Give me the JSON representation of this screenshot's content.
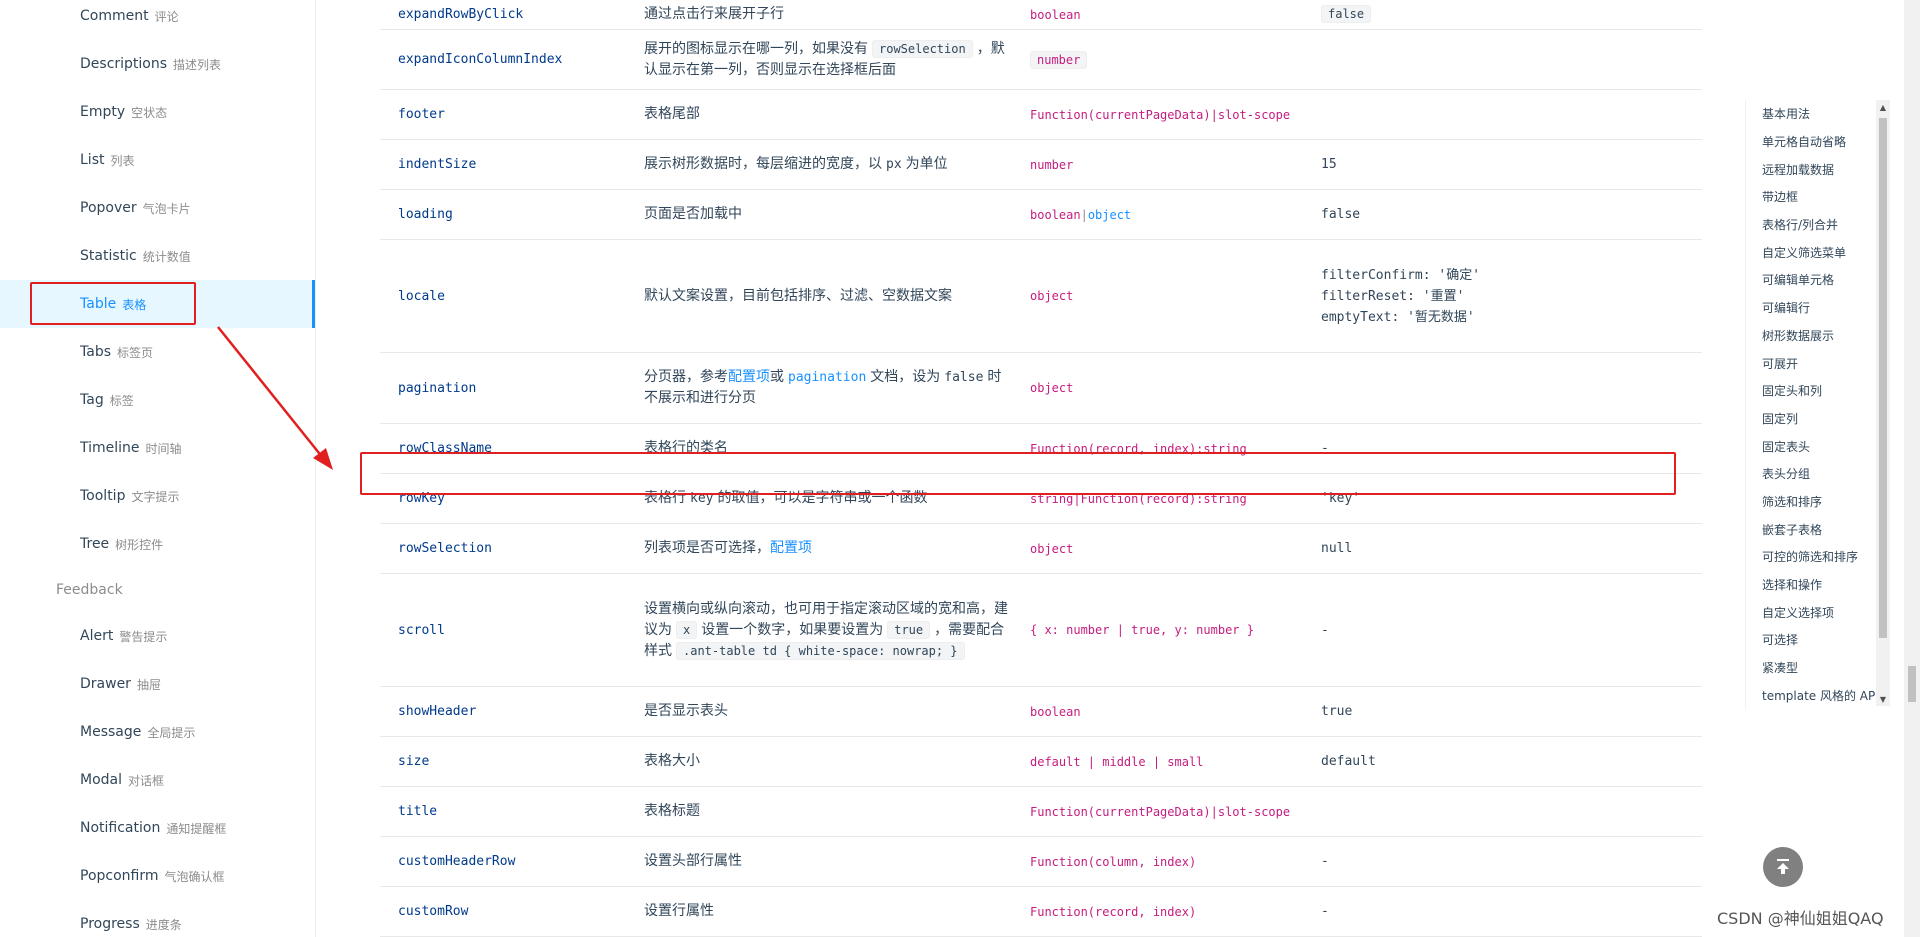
{
  "sidebar": {
    "items_top": [
      {
        "label": "Comment",
        "sub": "评论"
      },
      {
        "label": "Descriptions",
        "sub": "描述列表"
      },
      {
        "label": "Empty",
        "sub": "空状态"
      },
      {
        "label": "List",
        "sub": "列表"
      },
      {
        "label": "Popover",
        "sub": "气泡卡片"
      },
      {
        "label": "Statistic",
        "sub": "统计数值"
      },
      {
        "label": "Table",
        "sub": "表格"
      },
      {
        "label": "Tabs",
        "sub": "标签页"
      },
      {
        "label": "Tag",
        "sub": "标签"
      },
      {
        "label": "Timeline",
        "sub": "时间轴"
      },
      {
        "label": "Tooltip",
        "sub": "文字提示"
      },
      {
        "label": "Tree",
        "sub": "树形控件"
      }
    ],
    "group": "Feedback",
    "items_bottom": [
      {
        "label": "Alert",
        "sub": "警告提示"
      },
      {
        "label": "Drawer",
        "sub": "抽屉"
      },
      {
        "label": "Message",
        "sub": "全局提示"
      },
      {
        "label": "Modal",
        "sub": "对话框"
      },
      {
        "label": "Notification",
        "sub": "通知提醒框"
      },
      {
        "label": "Popconfirm",
        "sub": "气泡确认框"
      },
      {
        "label": "Progress",
        "sub": "进度条"
      }
    ]
  },
  "table": {
    "rows": [
      {
        "prop": "expandRowByClick",
        "desc": "通过点击行来展开子行",
        "type": "boolean",
        "default": "false"
      },
      {
        "prop": "expandIconColumnIndex",
        "desc_a": "展开的图标显示在哪一列，如果没有",
        "desc_code": "rowSelection",
        "desc_b": "，默认显示在第一列，否则显示在选择框后面",
        "type": "number",
        "default": ""
      },
      {
        "prop": "footer",
        "desc": "表格尾部",
        "type": "Function(currentPageData)|slot-scope",
        "default": ""
      },
      {
        "prop": "indentSize",
        "desc_a": "展示树形数据时，每层缩进的宽度，以",
        "desc_mono": "px",
        "desc_b": "为单位",
        "type": "number",
        "default": "15"
      },
      {
        "prop": "loading",
        "desc": "页面是否加载中",
        "type_a": "boolean",
        "type_sep": "|",
        "type_b": "object",
        "default": "false"
      },
      {
        "prop": "locale",
        "desc": "默认文案设置，目前包括排序、过滤、空数据文案",
        "type": "object",
        "default": "filterConfirm: '确定'\nfilterReset: '重置'\nemptyText: '暂无数据'"
      },
      {
        "prop": "pagination",
        "desc_a": "分页器，参考",
        "desc_link1": "配置项",
        "desc_mid": "或",
        "desc_link2": "pagination",
        "desc_b": "文档，设为",
        "desc_mono": "false",
        "desc_c": "时不展示和进行分页",
        "type": "object",
        "default": ""
      },
      {
        "prop": "rowClassName",
        "desc": "表格行的类名",
        "type": "Function(record, index):string",
        "default": "-"
      },
      {
        "prop": "rowKey",
        "desc_a": "表格行",
        "desc_mono": "key",
        "desc_b": "的取值，可以是字符串或一个函数",
        "type": "string|Function(record):string",
        "default": "'key'"
      },
      {
        "prop": "rowSelection",
        "desc_a": "列表项是否可选择，",
        "desc_link1": "配置项",
        "type": "object",
        "default": "null"
      },
      {
        "prop": "scroll",
        "desc_a": "设置横向或纵向滚动，也可用于指定滚动区域的宽和高，建议为",
        "desc_code1": "x",
        "desc_b": "设置一个数字，如果要设置为",
        "desc_code2": "true",
        "desc_c": "，需要配合样式",
        "desc_code3": ".ant-table td { white-space: nowrap; }",
        "type": "{ x: number | true, y: number }",
        "default": "-"
      },
      {
        "prop": "showHeader",
        "desc": "是否显示表头",
        "type": "boolean",
        "default": "true"
      },
      {
        "prop": "size",
        "desc": "表格大小",
        "type": "default | middle | small",
        "default": "default"
      },
      {
        "prop": "title",
        "desc": "表格标题",
        "type": "Function(currentPageData)|slot-scope",
        "default": ""
      },
      {
        "prop": "customHeaderRow",
        "desc": "设置头部行属性",
        "type": "Function(column, index)",
        "default": "-"
      },
      {
        "prop": "customRow",
        "desc": "设置行属性",
        "type": "Function(record, index)",
        "default": "-"
      }
    ]
  },
  "anchor": {
    "items": [
      "基本用法",
      "单元格自动省略",
      "远程加载数据",
      "带边框",
      "表格行/列合并",
      "自定义筛选菜单",
      "可编辑单元格",
      "可编辑行",
      "树形数据展示",
      "可展开",
      "固定头和列",
      "固定列",
      "固定表头",
      "表头分组",
      "筛选和排序",
      "嵌套子表格",
      "可控的筛选和排序",
      "选择和操作",
      "自定义选择项",
      "可选择",
      "紧凑型",
      "template 风格的 API"
    ]
  },
  "watermark": "CSDN @神仙姐姐QAQ",
  "colors": {
    "accent": "#1890ff",
    "annotation": "#e02020",
    "type": "#c41d7f",
    "prop": "#003a8c"
  },
  "icons": {
    "back_top": "arrow-up-to-line-icon"
  }
}
